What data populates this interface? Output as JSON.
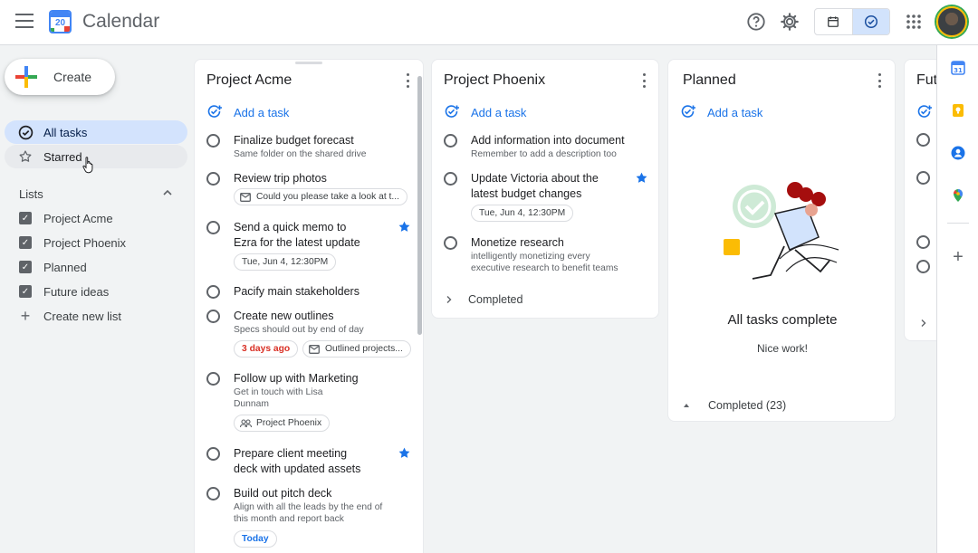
{
  "app": {
    "title": "Calendar",
    "logo_day": "20"
  },
  "sidebar": {
    "create_label": "Create",
    "nav": [
      {
        "label": "All tasks"
      },
      {
        "label": "Starred"
      }
    ],
    "lists_header": "Lists",
    "lists": [
      {
        "label": "Project Acme"
      },
      {
        "label": "Project Phoenix"
      },
      {
        "label": "Planned"
      },
      {
        "label": "Future ideas"
      }
    ],
    "create_list_label": "Create new list"
  },
  "columns": {
    "acme": {
      "title": "Project Acme",
      "add_task": "Add a task",
      "tasks": [
        {
          "title": "Finalize budget forecast",
          "desc": "Same folder on the shared drive"
        },
        {
          "title": "Review trip photos",
          "chip": "Could you please take a look at t..."
        },
        {
          "title": "Send a quick memo to",
          "title2": "Ezra for the latest update",
          "chip": "Tue, Jun 4, 12:30PM",
          "starred": true
        },
        {
          "title": "Pacify main stakeholders"
        },
        {
          "title": "Create new outlines",
          "desc": "Specs should out by end of day",
          "chip_due": "3 days ago",
          "chip": "Outlined projects..."
        },
        {
          "title": "Follow up with Marketing",
          "desc": "Get in touch with Lisa",
          "desc2": "Dunnam",
          "chip": "Project Phoenix"
        },
        {
          "title": "Prepare client meeting",
          "title2": "deck with updated assets",
          "starred": true
        },
        {
          "title": "Build out pitch deck",
          "desc": "Align with all the leads by the end of",
          "desc2": "this month and report back",
          "chip": "Today"
        }
      ]
    },
    "phoenix": {
      "title": "Project Phoenix",
      "add_task": "Add a task",
      "tasks": [
        {
          "title": "Add information into document",
          "desc": "Remember to add a description too"
        },
        {
          "title": "Update Victoria about the",
          "title2": "latest budget changes",
          "chip": "Tue, Jun 4, 12:30PM",
          "starred": true
        },
        {
          "title": "Monetize research",
          "desc": "intelligently monetizing every",
          "desc2": "executive research to benefit teams"
        }
      ],
      "completed_label": "Completed"
    },
    "planned": {
      "title": "Planned",
      "add_task": "Add a task",
      "empty_title": "All tasks complete",
      "empty_sub": "Nice work!",
      "completed_label": "Completed (23)"
    },
    "future": {
      "title": "Futu"
    }
  },
  "colors": {
    "accent": "#1a73e8",
    "selected_nav": "#d3e3fd",
    "due_red": "#d93025"
  }
}
